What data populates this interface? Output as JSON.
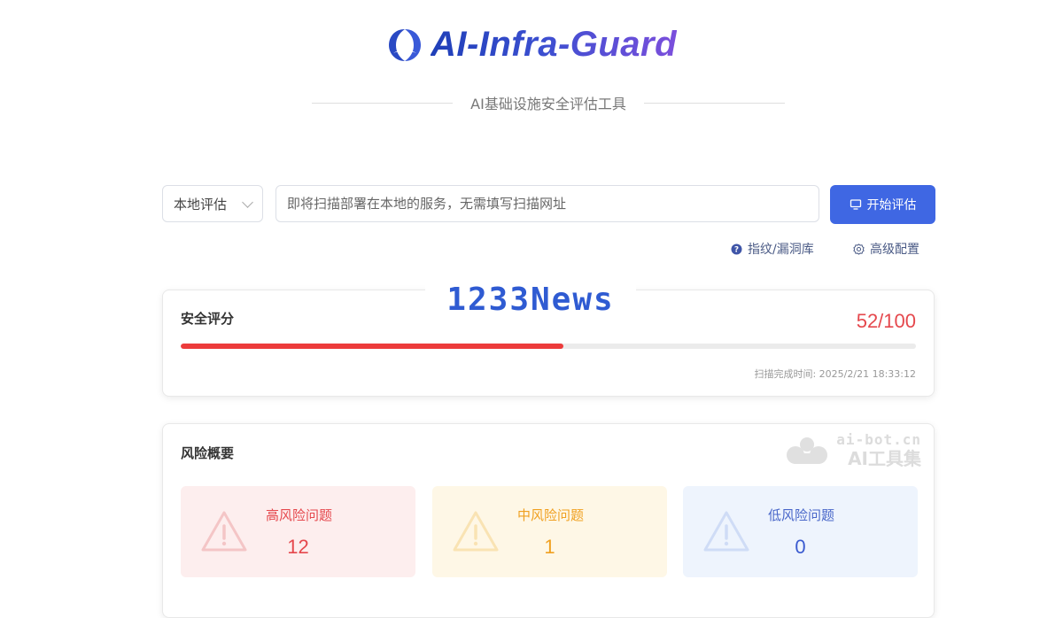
{
  "header": {
    "logo_text": "AI-Infra-Guard",
    "subtitle": "AI基础设施安全评估工具"
  },
  "scan_form": {
    "mode_select": "本地评估",
    "target_placeholder": "即将扫描部署在本地的服务，无需填写扫描网址",
    "start_label": "开始评估"
  },
  "links": {
    "fingerprint_label": "指纹/漏洞库",
    "advanced_label": "高级配置"
  },
  "watermark": {
    "text": "1233News"
  },
  "score": {
    "label": "安全评分",
    "value": "52/100",
    "percent": 52,
    "time_label": "扫描完成时间: 2025/2/21 18:33:12"
  },
  "risk": {
    "title": "风险概要",
    "watermark_url": "ai-bot.cn",
    "watermark_name": "AI工具集",
    "items": [
      {
        "label": "高风险问题",
        "count": "12"
      },
      {
        "label": "中风险问题",
        "count": "1"
      },
      {
        "label": "低风险问题",
        "count": "0"
      }
    ]
  },
  "colors": {
    "primary": "#3f67e3",
    "high": "#e5484d",
    "medium": "#f0a020",
    "low": "#3b5bd0"
  },
  "icons": {
    "logo": "crescent-logo-icon",
    "select": "chevron-down-icon",
    "start": "monitor-icon",
    "fingerprint": "question-circle-icon",
    "advanced": "gear-icon",
    "risk": "warning-triangle-icon"
  }
}
